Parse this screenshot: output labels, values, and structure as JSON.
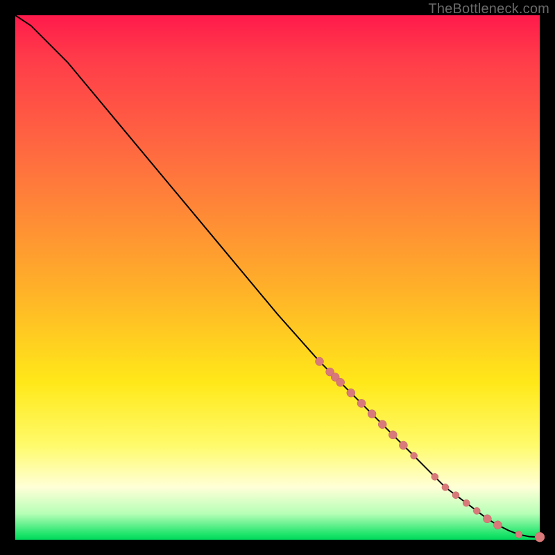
{
  "watermark": "TheBottleneck.com",
  "colors": {
    "dot": "#d97a7a",
    "curve": "#000000"
  },
  "chart_data": {
    "type": "line",
    "title": "",
    "xlabel": "",
    "ylabel": "",
    "xlim": [
      0,
      100
    ],
    "ylim": [
      0,
      100
    ],
    "grid": false,
    "legend": false,
    "series": [
      {
        "name": "curve",
        "x": [
          0,
          3,
          6,
          10,
          15,
          20,
          30,
          40,
          50,
          58,
          60,
          62,
          64,
          66,
          68,
          70,
          72,
          74,
          76,
          78,
          80,
          82,
          84,
          86,
          88,
          90,
          92,
          94,
          96,
          98,
          100
        ],
        "y": [
          100,
          98,
          95,
          91,
          85,
          79,
          67,
          55,
          43,
          34,
          32,
          30,
          28,
          26,
          24,
          22,
          20,
          18,
          16,
          14,
          12,
          10,
          8.5,
          7,
          5.5,
          4,
          2.8,
          1.8,
          1.0,
          0.6,
          0.5
        ]
      }
    ],
    "scatter_points": [
      {
        "x": 58,
        "y": 34,
        "r": 6
      },
      {
        "x": 60,
        "y": 32,
        "r": 6
      },
      {
        "x": 61,
        "y": 31,
        "r": 6
      },
      {
        "x": 62,
        "y": 30,
        "r": 6
      },
      {
        "x": 64,
        "y": 28,
        "r": 6
      },
      {
        "x": 66,
        "y": 26,
        "r": 6
      },
      {
        "x": 68,
        "y": 24,
        "r": 6
      },
      {
        "x": 70,
        "y": 22,
        "r": 6
      },
      {
        "x": 72,
        "y": 20,
        "r": 6
      },
      {
        "x": 74,
        "y": 18,
        "r": 6
      },
      {
        "x": 76,
        "y": 16,
        "r": 5
      },
      {
        "x": 80,
        "y": 12,
        "r": 5
      },
      {
        "x": 82,
        "y": 10,
        "r": 5
      },
      {
        "x": 84,
        "y": 8.5,
        "r": 5
      },
      {
        "x": 86,
        "y": 7,
        "r": 5
      },
      {
        "x": 88,
        "y": 5.5,
        "r": 5
      },
      {
        "x": 90,
        "y": 4,
        "r": 6
      },
      {
        "x": 92,
        "y": 2.8,
        "r": 6
      },
      {
        "x": 96,
        "y": 1.0,
        "r": 5
      },
      {
        "x": 100,
        "y": 0.5,
        "r": 7
      }
    ]
  }
}
